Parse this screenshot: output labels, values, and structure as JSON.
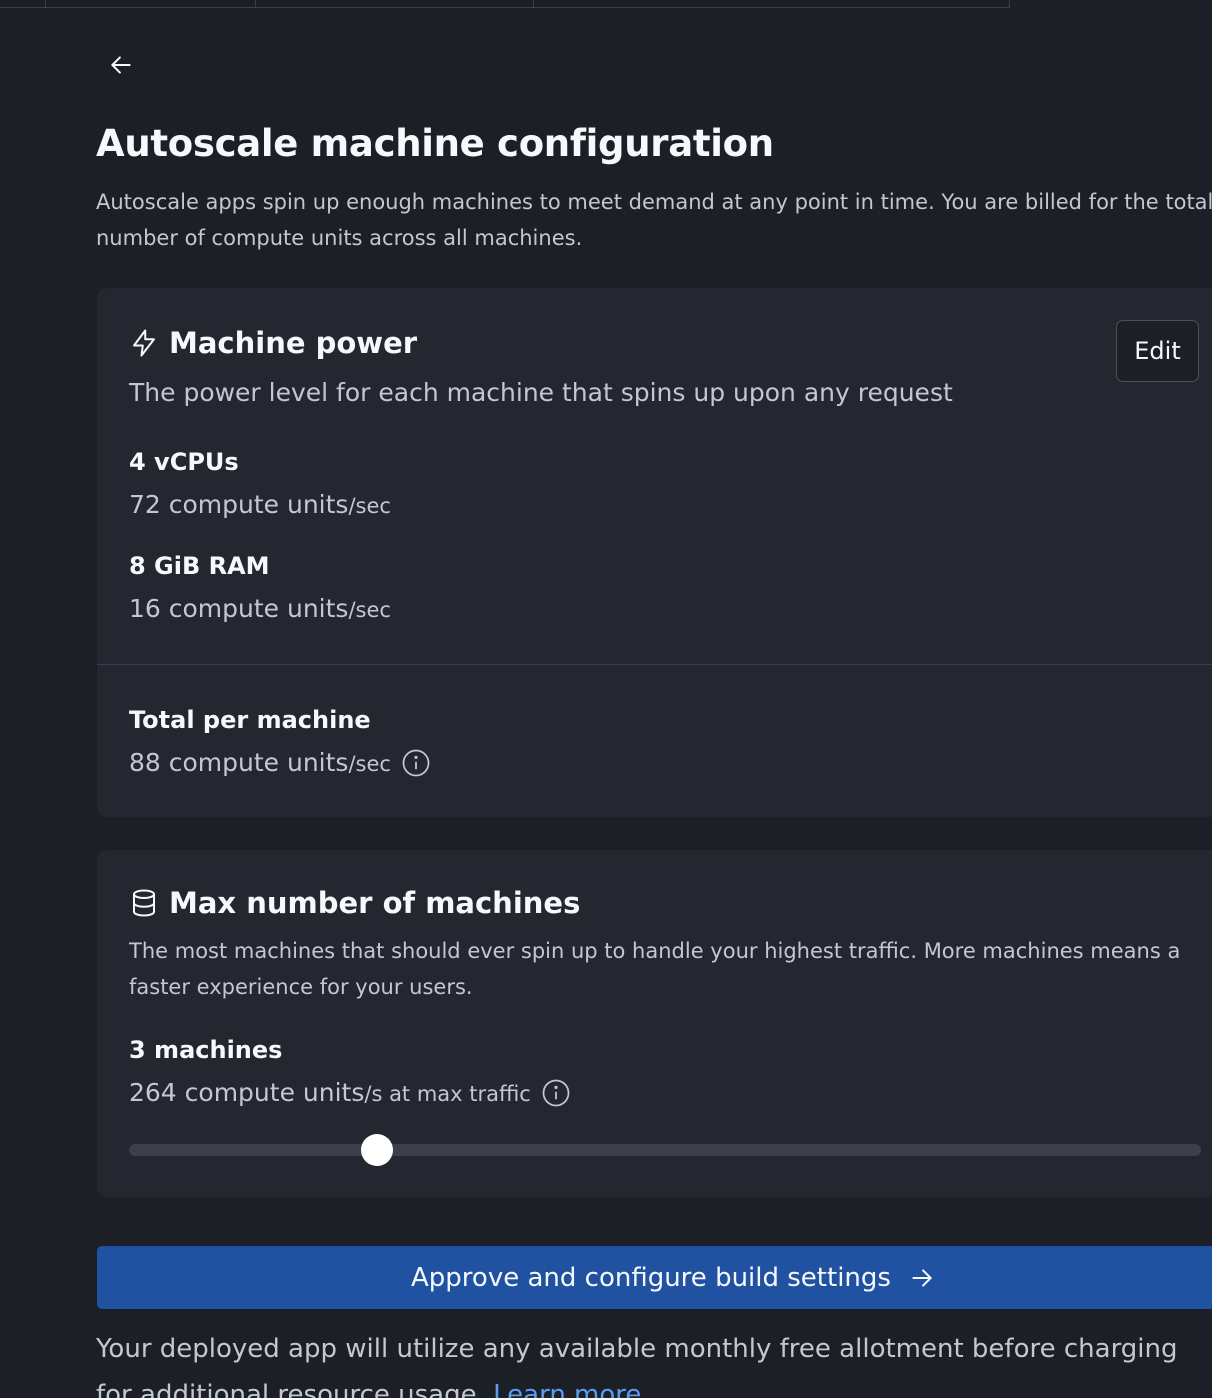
{
  "header": {
    "title": "Autoscale machine configuration",
    "description": "Autoscale apps spin up enough machines to meet demand at any point in time. You are billed for the total number of compute units across all machines."
  },
  "machine_power": {
    "icon": "lightning-icon",
    "title": "Machine power",
    "subtitle": "The power level for each machine that spins up upon any request",
    "edit_label": "Edit",
    "cpu": {
      "label": "4 vCPUs",
      "value": "72 compute units",
      "unit": "/sec"
    },
    "ram": {
      "label": "8 GiB RAM",
      "value": "16 compute units",
      "unit": "/sec"
    },
    "total": {
      "label": "Total per machine",
      "value": "88 compute units",
      "unit": "/sec"
    }
  },
  "max_machines": {
    "icon": "database-icon",
    "title": "Max number of machines",
    "subtitle": "The most machines that should ever spin up to handle your highest traffic. More machines means a faster experience for your users.",
    "count_label": "3 machines",
    "value": "264 compute units",
    "unit": "/s at max traffic",
    "slider_fraction": 0.231
  },
  "cta": {
    "label": "Approve and configure build settings"
  },
  "footer": {
    "text": "Your deployed app will utilize any available monthly free allotment before charging for additional resource usage.",
    "link_label": "Learn more"
  },
  "colors": {
    "background": "#1c1f26",
    "card": "#242730",
    "primary": "#2152a2",
    "link": "#5c9cf5"
  }
}
